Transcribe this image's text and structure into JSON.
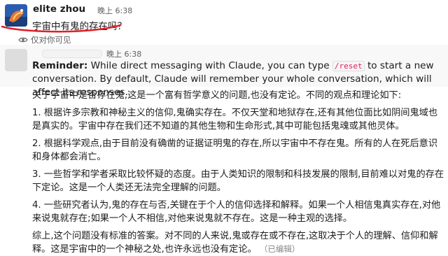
{
  "user": {
    "name": "elite zhou",
    "timestamp": "晚上 6:38",
    "message": "宇宙中有鬼的存在吗？"
  },
  "visibility_note": "仅对你可见",
  "bot": {
    "timestamp": "晚上 6:38",
    "reminder_label": "Reminder:",
    "reminder_before": " While direct messaging with Claude, you can type ",
    "reminder_code": "/reset",
    "reminder_after": " to start a new conversation. By default, Claude will remember your whole conversation, which will affect its responses."
  },
  "answer": {
    "paragraphs": [
      "关于宇宙中是否存在鬼,这是一个富有哲学意义的问题,也没有定论。不同的观点和理论如下:",
      "1. 根据许多宗教和神秘主义的信仰,鬼确实存在。不仅天堂和地狱存在,还有其他位面比如阴间鬼域也是真实的。宇宙中存在我们还不知道的其他生物和生命形式,其中可能包括鬼魂或其他灵体。",
      "2. 根据科学观点,由于目前没有确凿的证据证明鬼的存在,所以宇宙中不存在鬼。所有的人在死后意识和身体都会消亡。",
      "3. 一些哲学和学者采取比较怀疑的态度。由于人类知识的限制和科技发展的限制,目前难以对鬼的存在下定论。这是一个人类还无法完全理解的问题。",
      "4. 一些研究者认为,鬼的存在与否,关键在于个人的信仰选择和解释。如果一个人相信鬼真实存在,对他来说鬼就存在;如果一个人不相信,对他来说鬼就不存在。这是一种主观的选择。",
      "综上,这个问题没有标准的答案。对不同的人来说,鬼或存在或不存在,这取决于个人的理解、信仰和解释。这是宇宙中的一个神秘之处,也许永远也没有定论。"
    ],
    "edited_label": "（已编辑）"
  }
}
